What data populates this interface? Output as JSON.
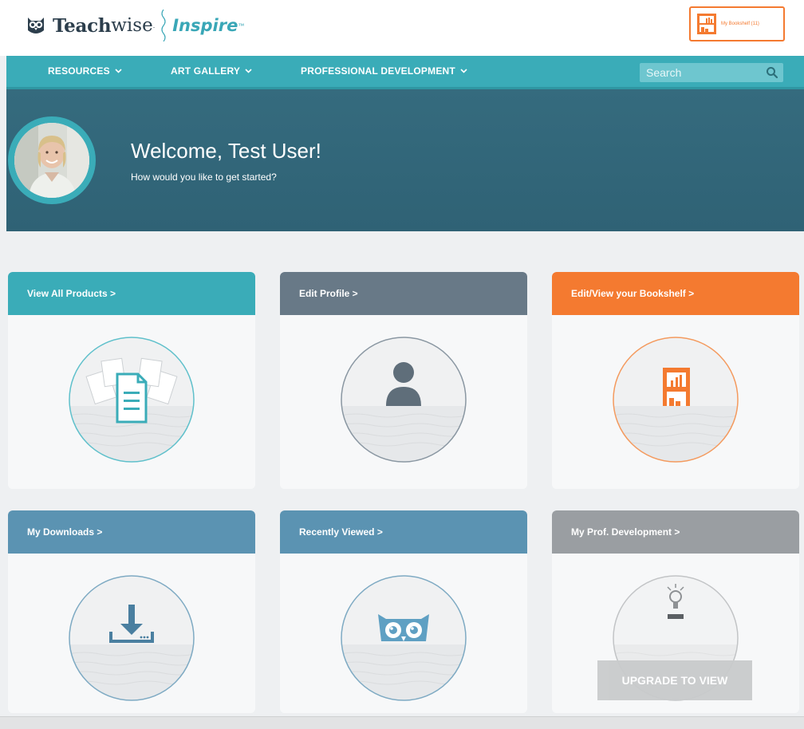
{
  "brand": {
    "name_bold": "Teach",
    "name_rest": "wise",
    "reg": ".",
    "product": "Inspire",
    "tm": "™"
  },
  "bookshelf_button": {
    "label": "My Bookshelf (11)"
  },
  "nav": {
    "items": [
      {
        "label": "RESOURCES"
      },
      {
        "label": "ART GALLERY"
      },
      {
        "label": "PROFESSIONAL DEVELOPMENT"
      }
    ],
    "search": {
      "placeholder": "Search"
    }
  },
  "hero": {
    "welcome": "Welcome, Test User!",
    "subtitle": "How would you like to get started?"
  },
  "cards": [
    {
      "title": "View All Products >",
      "color": "#3aacb8",
      "icon": "document-icon"
    },
    {
      "title": "Edit Profile >",
      "color": "#687987",
      "icon": "user-icon"
    },
    {
      "title": "Edit/View your Bookshelf >",
      "color": "#f47a30",
      "icon": "bookshelf-icon"
    },
    {
      "title": "My Downloads >",
      "color": "#5b93b2",
      "icon": "download-icon"
    },
    {
      "title": "Recently Viewed >",
      "color": "#5b93b2",
      "icon": "owl-icon"
    },
    {
      "title": "My Prof. Development >",
      "color": "#9a9ea2",
      "icon": "lightbulb-icon",
      "overlay": "UPGRADE TO VIEW"
    }
  ],
  "colors": {
    "teal": "#3aacb8",
    "hero": "#356b7e",
    "orange": "#f47a30",
    "slate": "#687987",
    "blue": "#5b93b2",
    "gray": "#9a9ea2"
  }
}
